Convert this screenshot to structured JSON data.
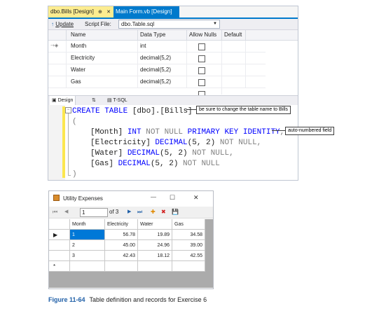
{
  "vs": {
    "tabs": [
      {
        "label": "dbo.Bills [Design]",
        "pin": "⊕",
        "close": "✕"
      },
      {
        "label": "Main Form.vb [Design]"
      }
    ],
    "toolbar": {
      "update_label": "Update",
      "script_file_label": "Script File:",
      "script_file_value": "dbo.Table.sql"
    },
    "columns": [
      "Name",
      "Data Type",
      "Allow Nulls",
      "Default"
    ],
    "rows": [
      {
        "key": true,
        "name": "Month",
        "type": "int",
        "allow_nulls": false
      },
      {
        "key": false,
        "name": "Electricity",
        "type": "decimal(5,2)",
        "allow_nulls": false
      },
      {
        "key": false,
        "name": "Water",
        "type": "decimal(5,2)",
        "allow_nulls": false
      },
      {
        "key": false,
        "name": "Gas",
        "type": "decimal(5,2)",
        "allow_nulls": false
      }
    ],
    "pane_tabs": {
      "design": "Design",
      "swap": "⇅",
      "tsql": "T-SQL"
    },
    "code": {
      "l1_kw": "CREATE TABLE ",
      "l1_rest": "[dbo].[Bills]",
      "l2": "(",
      "l3_a": "[Month] ",
      "l3_b": "INT ",
      "l3_c": "NOT NULL ",
      "l3_d": "PRIMARY KEY IDENTITY",
      "l3_e": ",",
      "l4_a": "[Electricity] ",
      "l4_b": "DECIMAL",
      "l4_c": "(5, 2) ",
      "l4_d": "NOT NULL",
      "l4_e": ",",
      "l5_a": "[Water] ",
      "l5_b": "DECIMAL",
      "l5_c": "(5, 2) ",
      "l5_d": "NOT NULL",
      "l5_e": ",",
      "l6_a": "[Gas] ",
      "l6_b": "DECIMAL",
      "l6_c": "(5, 2) ",
      "l6_d": "NOT NULL",
      "l7": ")"
    }
  },
  "callouts": {
    "table_name": "be sure to change the table name to Bills",
    "auto_numbered": "auto-numbered field"
  },
  "form": {
    "title": "Utility Expenses",
    "window_controls": {
      "minimize": "—",
      "maximize": "☐",
      "close": "✕"
    },
    "nav": {
      "first": "⏮",
      "prev": "◀",
      "position": "1",
      "of_label": "of 3",
      "next": "▶",
      "last": "⏭",
      "add": "✚",
      "delete": "✖",
      "save": "💾"
    },
    "headers": [
      "Month",
      "Electricity",
      "Water",
      "Gas"
    ],
    "rows": [
      {
        "indicator": "▶",
        "month": "1",
        "electricity": "56.78",
        "water": "19.89",
        "gas": "34.58"
      },
      {
        "indicator": "",
        "month": "2",
        "electricity": "45.00",
        "water": "24.96",
        "gas": "39.00"
      },
      {
        "indicator": "",
        "month": "3",
        "electricity": "42.43",
        "water": "18.12",
        "gas": "42.55"
      },
      {
        "indicator": "*",
        "month": "",
        "electricity": "",
        "water": "",
        "gas": ""
      }
    ]
  },
  "caption": {
    "number": "Figure 11-64",
    "text": "Table definition and records for Exercise 6"
  },
  "colors": {
    "accent": "#007acc",
    "active_tab": "#fcec90",
    "caption_blue": "#1f5fa7",
    "selection": "#0078d7"
  }
}
